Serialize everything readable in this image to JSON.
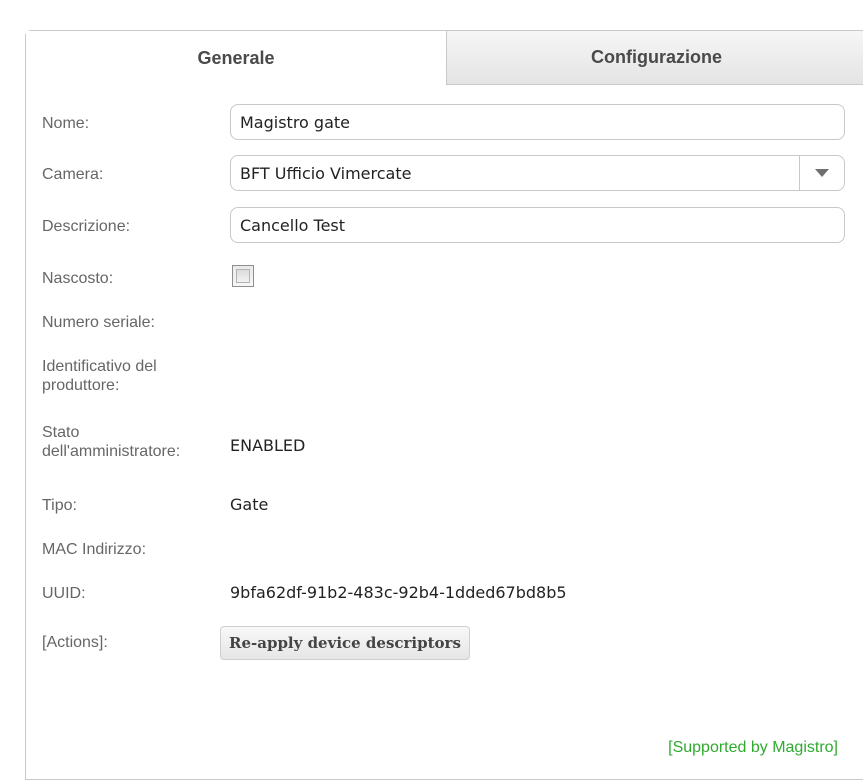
{
  "tabs": [
    {
      "label": "Generale",
      "active": true
    },
    {
      "label": "Configurazione",
      "active": false
    }
  ],
  "form": {
    "nome": {
      "label": "Nome:",
      "value": "Magistro gate"
    },
    "camera": {
      "label": "Camera:",
      "value": "BFT Ufficio Vimercate"
    },
    "descrizione": {
      "label": "Descrizione:",
      "value": "Cancello Test"
    },
    "nascosto": {
      "label": "Nascosto:",
      "checked": false
    },
    "numero_seriale": {
      "label": "Numero seriale:",
      "value": ""
    },
    "identificativo": {
      "label_line1": "Identificativo del",
      "label_line2": "produttore:",
      "value": ""
    },
    "stato": {
      "label_line1": "Stato",
      "label_line2": "dell'amministratore:",
      "value": "ENABLED"
    },
    "tipo": {
      "label": "Tipo:",
      "value": "Gate"
    },
    "mac": {
      "label": "MAC Indirizzo:",
      "value": ""
    },
    "uuid": {
      "label": "UUID:",
      "value": "9bfa62df-91b2-483c-92b4-1dded67bd8b5"
    },
    "actions": {
      "label": "[Actions]:",
      "button_label": "Re-apply device descriptors"
    }
  },
  "footer": {
    "text": "[Supported by Magistro]"
  },
  "colors": {
    "footer": "#2faa2f",
    "label": "#666666",
    "inactive_tab_bg": "#e4e4e4"
  },
  "icons": {
    "select_arrow": "chevron-down-icon"
  }
}
